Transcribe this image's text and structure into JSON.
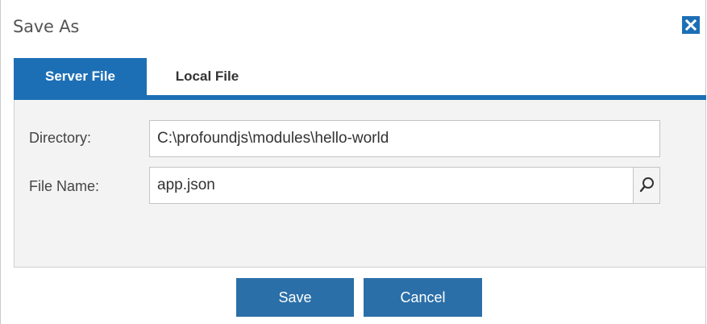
{
  "dialog": {
    "title": "Save As",
    "close_icon": "close-icon",
    "accent_color": "#1d6fb5"
  },
  "tabs": [
    {
      "label": "Server File",
      "active": true
    },
    {
      "label": "Local File",
      "active": false
    }
  ],
  "form": {
    "directory_label": "Directory:",
    "directory_value": "C:\\profoundjs\\modules\\hello-world",
    "filename_label": "File Name:",
    "filename_value": "app.json",
    "search_icon": "search-icon"
  },
  "buttons": {
    "save_label": "Save",
    "cancel_label": "Cancel"
  }
}
